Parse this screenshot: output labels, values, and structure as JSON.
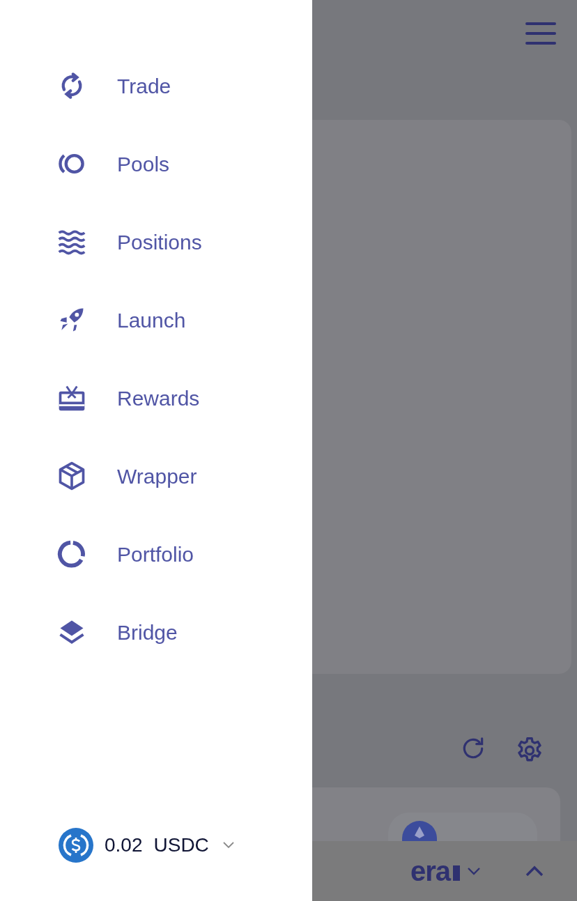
{
  "menu": {
    "items": [
      {
        "label": "Trade"
      },
      {
        "label": "Pools"
      },
      {
        "label": "Positions"
      },
      {
        "label": "Launch"
      },
      {
        "label": "Rewards"
      },
      {
        "label": "Wrapper"
      },
      {
        "label": "Portfolio"
      },
      {
        "label": "Bridge"
      }
    ]
  },
  "balance": {
    "amount": "0.02",
    "currency": "USDC"
  },
  "background": {
    "network": "era"
  }
}
